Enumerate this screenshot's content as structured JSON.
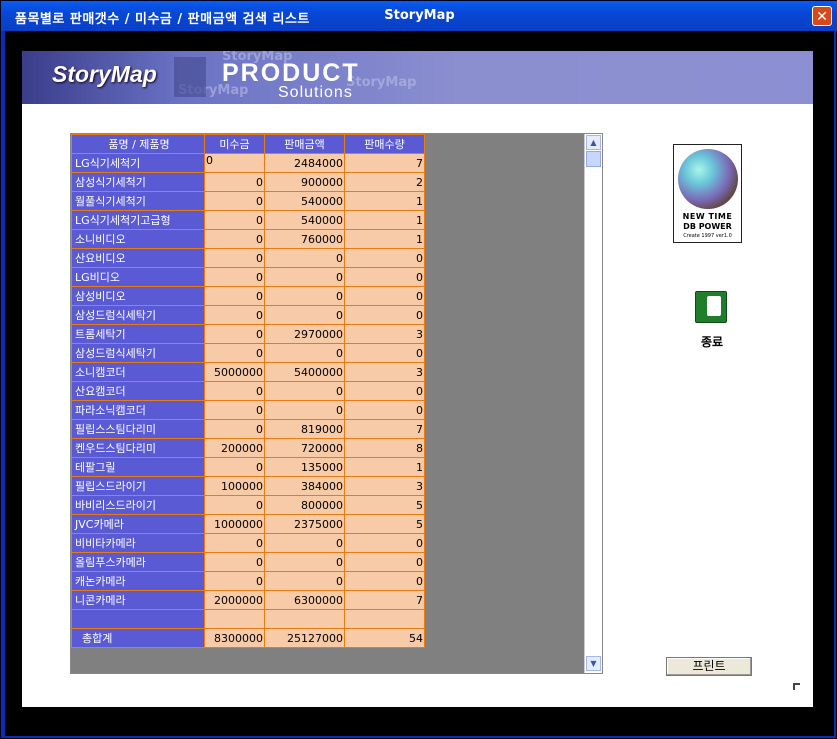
{
  "window": {
    "title_left": "품목별로 판매갯수 / 미수금 / 판매금액  검색 리스트",
    "title_center": "StoryMap"
  },
  "banner": {
    "logo": "StoryMap",
    "product": "PRODUCT",
    "solutions": "Solutions",
    "ghost_text": "StoryMap"
  },
  "grid": {
    "headers": [
      "품명 / 제품명",
      "미수금",
      "판매금액",
      "판매수량"
    ],
    "rows": [
      {
        "name": "LG식기세척기",
        "unpaid": "0",
        "sales": "2484000",
        "qty": "7"
      },
      {
        "name": "삼성식기세척기",
        "unpaid": "0",
        "sales": "900000",
        "qty": "2"
      },
      {
        "name": "월풀식기세척기",
        "unpaid": "0",
        "sales": "540000",
        "qty": "1"
      },
      {
        "name": "LG식기세척기고급형",
        "unpaid": "0",
        "sales": "540000",
        "qty": "1"
      },
      {
        "name": "소니비디오",
        "unpaid": "0",
        "sales": "760000",
        "qty": "1"
      },
      {
        "name": "산요비디오",
        "unpaid": "0",
        "sales": "0",
        "qty": "0"
      },
      {
        "name": "LG비디오",
        "unpaid": "0",
        "sales": "0",
        "qty": "0"
      },
      {
        "name": "삼성비디오",
        "unpaid": "0",
        "sales": "0",
        "qty": "0"
      },
      {
        "name": "삼성드럼식세탁기",
        "unpaid": "0",
        "sales": "0",
        "qty": "0"
      },
      {
        "name": "트롬세탁기",
        "unpaid": "0",
        "sales": "2970000",
        "qty": "3"
      },
      {
        "name": "삼성드럼식세탁기",
        "unpaid": "0",
        "sales": "0",
        "qty": "0"
      },
      {
        "name": "소니캠코더",
        "unpaid": "5000000",
        "sales": "5400000",
        "qty": "3"
      },
      {
        "name": "산요캠코더",
        "unpaid": "0",
        "sales": "0",
        "qty": "0"
      },
      {
        "name": "파라소닉캠코더",
        "unpaid": "0",
        "sales": "0",
        "qty": "0"
      },
      {
        "name": "필립스스팀다리미",
        "unpaid": "0",
        "sales": "819000",
        "qty": "7"
      },
      {
        "name": "켄우드스팀다리미",
        "unpaid": "200000",
        "sales": "720000",
        "qty": "8"
      },
      {
        "name": "테팔그릴",
        "unpaid": "0",
        "sales": "135000",
        "qty": "1"
      },
      {
        "name": "필립스드라이기",
        "unpaid": "100000",
        "sales": "384000",
        "qty": "3"
      },
      {
        "name": "바비리스드라이기",
        "unpaid": "0",
        "sales": "800000",
        "qty": "5"
      },
      {
        "name": "JVC카메라",
        "unpaid": "1000000",
        "sales": "2375000",
        "qty": "5"
      },
      {
        "name": "비비타카메라",
        "unpaid": "0",
        "sales": "0",
        "qty": "0"
      },
      {
        "name": "올림푸스카메라",
        "unpaid": "0",
        "sales": "0",
        "qty": "0"
      },
      {
        "name": "캐논카메라",
        "unpaid": "0",
        "sales": "0",
        "qty": "0"
      },
      {
        "name": "니콘카메라",
        "unpaid": "2000000",
        "sales": "6300000",
        "qty": "7"
      },
      {
        "name": "",
        "unpaid": "",
        "sales": "",
        "qty": ""
      },
      {
        "name": "총합계",
        "unpaid": "8300000",
        "sales": "25127000",
        "qty": "54"
      }
    ]
  },
  "side": {
    "newtime_line1": "NEW   TIME",
    "newtime_line2": "DB POWER",
    "newtime_line3": "Create 1997 ver1.0",
    "exit_label": "종료",
    "print_label": "프린트"
  }
}
